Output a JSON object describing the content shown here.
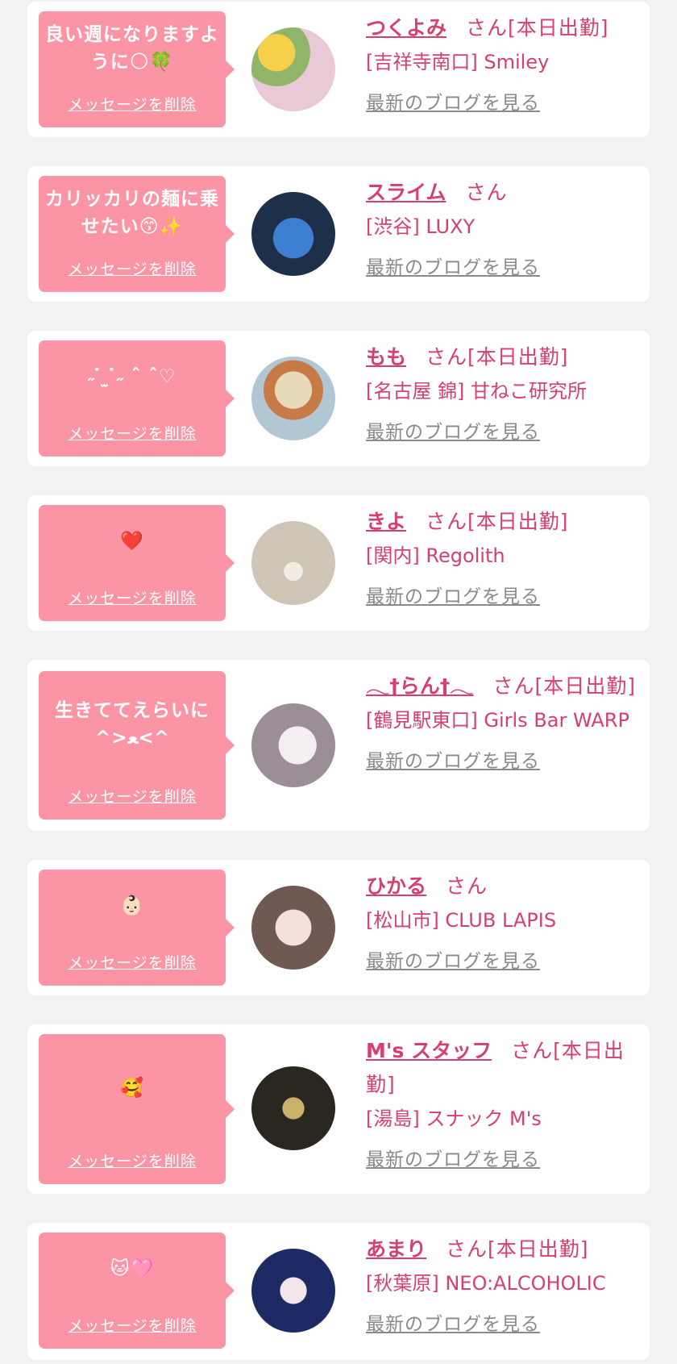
{
  "delete_label": "メッセージを削除",
  "blog_label": "最新のブログを見る",
  "colors": {
    "accent": "#d6406a",
    "bubble": "#fb94a4",
    "muted": "#8a8a8a",
    "background": "#f2f2f2"
  },
  "items": [
    {
      "message": "良い週になりますように🌕🍀",
      "name": "つくよみ",
      "suffix": "さん[本日出勤]",
      "shop": "[吉祥寺南口] Smiley"
    },
    {
      "message": "カリッカリの麺に乗せたい😙✨",
      "name": "スライム",
      "suffix": "さん",
      "shop": "[渋谷] LUXY"
    },
    {
      "message": "˶ ̇ ̫ ̇˶ ˆ ˆ♡",
      "name": "もも",
      "suffix": "さん[本日出勤]",
      "shop": "[名古屋 錦] 甘ねこ研究所"
    },
    {
      "message": "❤️",
      "name": "きよ",
      "suffix": "さん[本日出勤]",
      "shop": "[関内] Regolith"
    },
    {
      "message": "生きててえらいに^>ﻌ<^",
      "name": "𓂃†らん†𓂃",
      "suffix": "さん[本日出勤]",
      "shop": "[鶴見駅東口] Girls Bar WARP"
    },
    {
      "message": "👶🏻",
      "name": "ひかる",
      "suffix": "さん",
      "shop": "[松山市] CLUB LAPIS"
    },
    {
      "message": "🥰",
      "name": "M's スタッフ",
      "suffix": "さん[本日出勤]",
      "shop": "[湯島] スナック M's"
    },
    {
      "message": "🐱🩷",
      "name": "あまり",
      "suffix": "さん[本日出勤]",
      "shop": "[秋葉原] NEO:ALCOHOLIC"
    }
  ]
}
